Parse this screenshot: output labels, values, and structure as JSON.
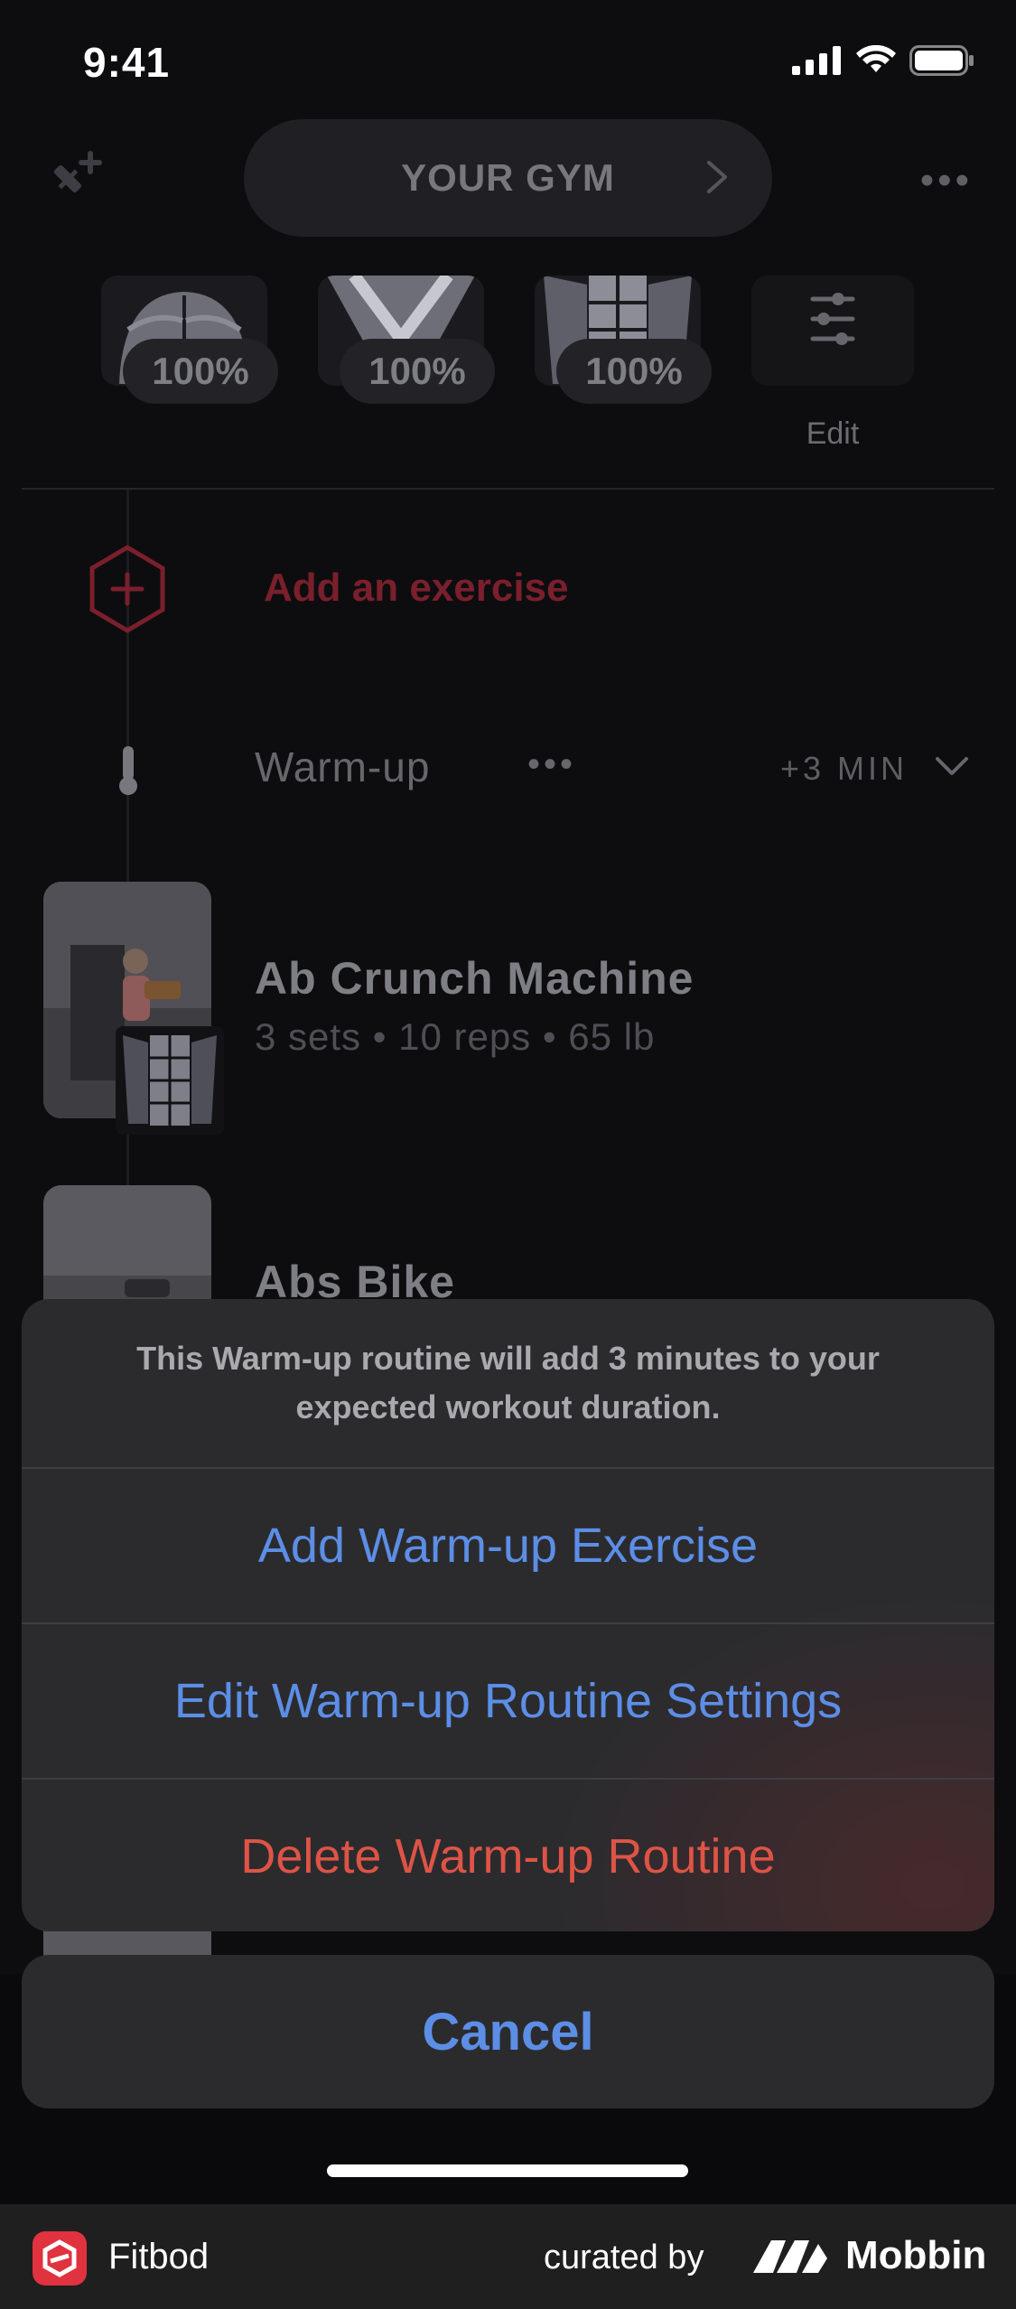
{
  "status_bar": {
    "time": "9:41"
  },
  "header": {
    "title": "YOUR GYM"
  },
  "muscle_groups": [
    {
      "name": "chest",
      "percent": "100%"
    },
    {
      "name": "back",
      "percent": "100%"
    },
    {
      "name": "abs",
      "percent": "100%"
    }
  ],
  "edit_label": "Edit",
  "add_exercise_label": "Add an exercise",
  "warmup": {
    "label": "Warm-up",
    "more": "•••",
    "duration": "+3 MIN"
  },
  "exercises": [
    {
      "name": "Ab Crunch Machine",
      "detail": "3 sets • 10 reps • 65 lb"
    },
    {
      "name": "Abs Bike",
      "detail": ""
    }
  ],
  "action_sheet": {
    "message": "This Warm-up routine will add 3 minutes to your expected workout duration.",
    "actions": [
      {
        "label": "Add Warm-up Exercise",
        "style": "default"
      },
      {
        "label": "Edit Warm-up Routine Settings",
        "style": "default"
      },
      {
        "label": "Delete Warm-up Routine",
        "style": "destructive"
      }
    ],
    "cancel_label": "Cancel"
  },
  "colors": {
    "action_blue": "#5c8ee6",
    "destructive_red": "#dd5446",
    "brand_red": "#e0323f"
  },
  "footer": {
    "app_name": "Fitbod",
    "curated_by": "curated by",
    "brand": "Mobbin"
  }
}
